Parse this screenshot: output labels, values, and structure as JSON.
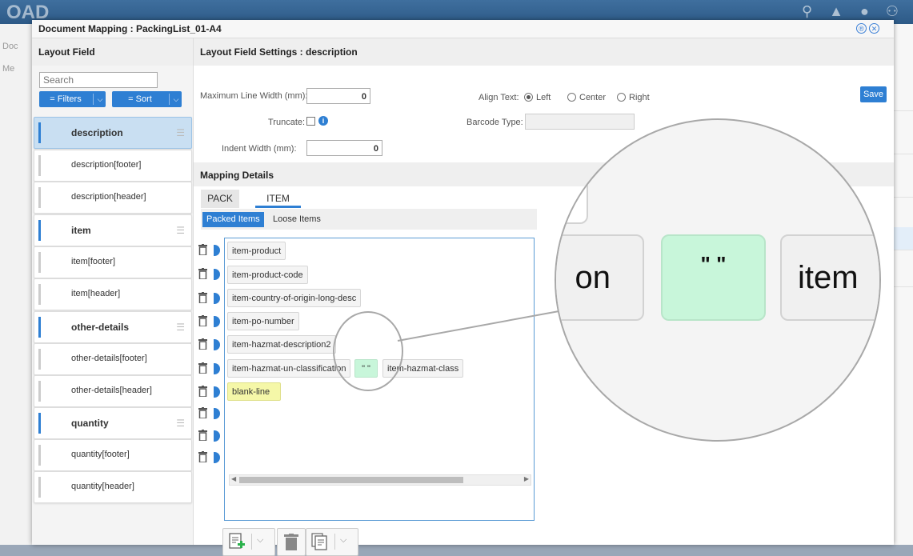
{
  "background": {
    "logo": "OAD",
    "side_labels": [
      "Doc",
      "Me"
    ]
  },
  "dialog": {
    "title": "Document Mapping : PackingList_01-A4"
  },
  "left_panel": {
    "header": "Layout Field",
    "search_placeholder": "Search",
    "filters_label": "= Filters",
    "sort_label": "= Sort",
    "items": [
      {
        "label": "description",
        "main": true,
        "selected": true
      },
      {
        "label": "description[footer]"
      },
      {
        "label": "description[header]"
      },
      {
        "label": "item",
        "main": true
      },
      {
        "label": "item[footer]"
      },
      {
        "label": "item[header]"
      },
      {
        "label": "other-details",
        "main": true
      },
      {
        "label": "other-details[footer]"
      },
      {
        "label": "other-details[header]"
      },
      {
        "label": "quantity",
        "main": true
      },
      {
        "label": "quantity[footer]"
      },
      {
        "label": "quantity[header]"
      }
    ]
  },
  "settings": {
    "header": "Layout Field Settings : description",
    "max_line_width_label": "Maximum Line Width (mm):",
    "max_line_width_value": "0",
    "truncate_label": "Truncate:",
    "indent_width_label": "Indent Width (mm):",
    "indent_width_value": "0",
    "align_text_label": "Align Text:",
    "align_left": "Left",
    "align_center": "Center",
    "align_right": "Right",
    "align_selected": "Left",
    "barcode_type_label": "Barcode Type:",
    "save_label": "Save"
  },
  "mapping": {
    "header": "Mapping Details",
    "tabs": [
      "PACK",
      "ITEM"
    ],
    "active_tab": "ITEM",
    "subtabs": [
      "Packed Items",
      "Loose Items"
    ],
    "active_subtab": "Packed Items",
    "rows": [
      {
        "chips": [
          {
            "text": "item-product",
            "style": "normal"
          }
        ]
      },
      {
        "chips": [
          {
            "text": "item-product-code",
            "style": "normal"
          }
        ]
      },
      {
        "chips": [
          {
            "text": "item-country-of-origin-long-desc",
            "style": "normal"
          }
        ]
      },
      {
        "chips": [
          {
            "text": "item-po-number",
            "style": "normal"
          }
        ]
      },
      {
        "chips": [
          {
            "text": "item-hazmat-description2",
            "style": "normal"
          }
        ]
      },
      {
        "chips": [
          {
            "text": "item-hazmat-un-classification",
            "style": "normal"
          },
          {
            "text": "\" \"",
            "style": "green"
          },
          {
            "text": "item-hazmat-class",
            "style": "normal"
          }
        ]
      },
      {
        "chips": [
          {
            "text": "blank-line",
            "style": "yellow"
          }
        ]
      },
      {
        "chips": []
      },
      {
        "chips": []
      },
      {
        "chips": []
      }
    ]
  },
  "magnifier": {
    "left_text": "on",
    "middle_text": "\" \"",
    "right_text": "item"
  },
  "colors": {
    "accent": "#2e7fd3",
    "green_chip": "#c8f6da",
    "yellow_chip": "#f5f7a8"
  },
  "icons": {
    "delete": "trash-icon",
    "add": "add-document-icon",
    "copy": "copy-icon"
  }
}
